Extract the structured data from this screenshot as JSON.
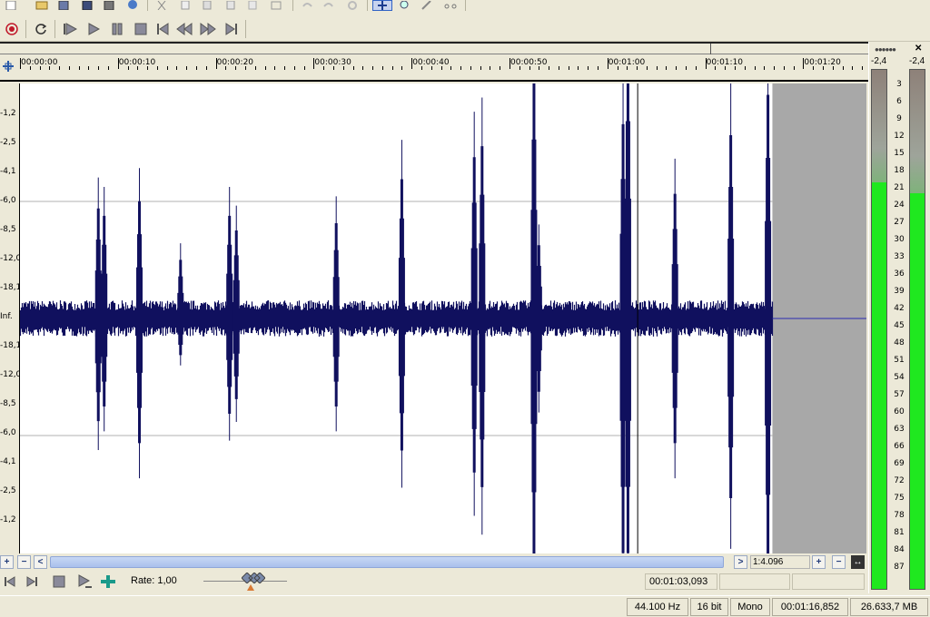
{
  "toolbar_top": {
    "icons": [
      "new-file-icon",
      "open-folder-icon",
      "save-icon",
      "save-as-icon",
      "save-all-icon",
      "properties-icon",
      "cut-icon",
      "copy-icon",
      "paste-icon",
      "paste-new-icon",
      "paste-mix-icon",
      "crop-icon",
      "undo-icon",
      "redo-icon",
      "repeat-icon",
      "edit-tool-icon",
      "magnify-tool-icon",
      "pencil-tool-icon",
      "scrub-tool-icon"
    ]
  },
  "toolbar_transport": {
    "icons": [
      "record-icon",
      "loop-icon",
      "play-from-start-icon",
      "play-icon",
      "pause-icon",
      "stop-icon",
      "go-to-start-icon",
      "rewind-icon",
      "fast-forward-icon",
      "go-to-end-icon"
    ]
  },
  "ruler": {
    "labels": [
      "00:00:00",
      "00:00:10",
      "00:00:20",
      "00:00:30",
      "00:00:40",
      "00:00:50",
      "00:01:00",
      "00:01:10",
      "00:01:20"
    ]
  },
  "yaxis": {
    "labels": [
      "-1,2",
      "-2,5",
      "-4,1",
      "-6,0",
      "-8,5",
      "-12,0",
      "-18,1",
      "Inf.",
      "-18,1",
      "-12,0",
      "-8,5",
      "-6,0",
      "-4,1",
      "-2,5",
      "-1,2"
    ]
  },
  "waveform": {
    "color": "#10105e",
    "duration_s": 76.852,
    "cursor_s": 63.093,
    "view_end_s": 86,
    "spikes": [
      {
        "t": 8.0,
        "up": 0.3,
        "down": 0.28
      },
      {
        "t": 8.6,
        "up": 0.28,
        "down": 0.24
      },
      {
        "t": 12.2,
        "up": 0.32,
        "down": 0.34
      },
      {
        "t": 16.4,
        "up": 0.16,
        "down": 0.1
      },
      {
        "t": 21.4,
        "up": 0.28,
        "down": 0.26
      },
      {
        "t": 22.1,
        "up": 0.24,
        "down": 0.22
      },
      {
        "t": 32.3,
        "up": 0.26,
        "down": 0.24
      },
      {
        "t": 39.0,
        "up": 0.38,
        "down": 0.36
      },
      {
        "t": 46.4,
        "up": 0.44,
        "down": 0.42
      },
      {
        "t": 47.2,
        "up": 0.47,
        "down": 0.46
      },
      {
        "t": 52.5,
        "up": 0.68,
        "down": 0.66
      },
      {
        "t": 53.0,
        "up": 0.2,
        "down": 0.2
      },
      {
        "t": 61.6,
        "up": 0.53,
        "down": 0.64
      },
      {
        "t": 62.1,
        "up": 0.75,
        "down": 0.64
      },
      {
        "t": 66.9,
        "up": 0.34,
        "down": 0.34
      },
      {
        "t": 72.6,
        "up": 0.5,
        "down": 0.49
      },
      {
        "t": 76.4,
        "up": 0.61,
        "down": 0.67
      }
    ]
  },
  "scrollbar": {
    "zoom_ratio": "1:4.096"
  },
  "transport_bottom": {
    "rate_label": "Rate: 1,00",
    "position_time": "00:01:03,093"
  },
  "statusbar": {
    "sample_rate": "44.100 Hz",
    "bit_depth": "16 bit",
    "channels": "Mono",
    "duration": "00:01:16,852",
    "free_space": "26.633,7 MB"
  },
  "vu_meter": {
    "peak_left": "-2,4",
    "peak_right": "-2,4",
    "scale": [
      "3",
      "6",
      "9",
      "12",
      "15",
      "18",
      "21",
      "24",
      "27",
      "30",
      "33",
      "36",
      "39",
      "42",
      "45",
      "48",
      "51",
      "54",
      "57",
      "60",
      "63",
      "66",
      "69",
      "72",
      "75",
      "78",
      "81",
      "84",
      "87"
    ],
    "level_color": "#1fe81f"
  }
}
